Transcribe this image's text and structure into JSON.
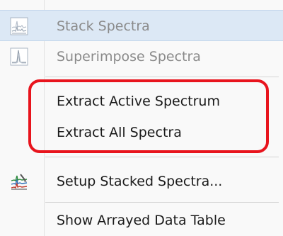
{
  "menu": {
    "items": [
      {
        "label": "Stack Spectra",
        "icon": "stack-spectra-icon",
        "state": "highlighted-disabled"
      },
      {
        "label": "Superimpose Spectra",
        "icon": "superimpose-spectra-icon",
        "state": "disabled"
      },
      {
        "label": "Extract Active Spectrum",
        "icon": "",
        "state": "enabled"
      },
      {
        "label": "Extract All Spectra",
        "icon": "",
        "state": "enabled"
      },
      {
        "label": "Setup Stacked Spectra...",
        "icon": "setup-stacked-spectra-icon",
        "state": "enabled"
      },
      {
        "label": "Show Arrayed Data Table",
        "icon": "",
        "state": "enabled"
      }
    ]
  },
  "colors": {
    "highlight_box": "#e8141d",
    "hover_bg": "#dce8f5",
    "disabled_text": "#8a8a8a"
  }
}
